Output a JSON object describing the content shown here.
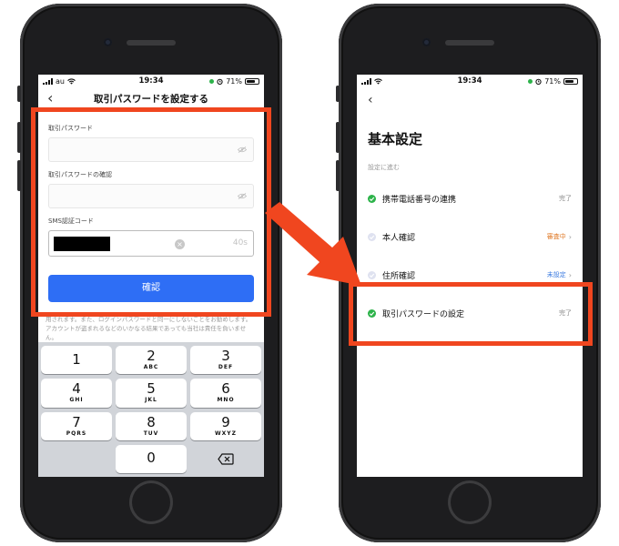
{
  "colors": {
    "highlight": "#f0461f",
    "confirm_button": "#2e6ef5",
    "done_green": "#2db34a",
    "review_orange": "#e07c2b",
    "unset_blue": "#3b7be0"
  },
  "left_screen": {
    "status": {
      "carrier": "au",
      "time": "19:34",
      "battery": "71%"
    },
    "nav": {
      "back": "‹",
      "title": "取引パスワードを設定する"
    },
    "form": {
      "password_label": "取引パスワード",
      "confirm_label": "取引パスワードの確認",
      "sms_label": "SMS認証コード",
      "timer": "40s"
    },
    "confirm_button": "確認",
    "notice": "用されます。また、ログインパスワードと同一にしないことをお勧めします。アカウントが盗まれるなどのいかなる結果であっても当社は責任を負いません。",
    "keypad": [
      {
        "n": "1",
        "l": ""
      },
      {
        "n": "2",
        "l": "ABC"
      },
      {
        "n": "3",
        "l": "DEF"
      },
      {
        "n": "4",
        "l": "GHI"
      },
      {
        "n": "5",
        "l": "JKL"
      },
      {
        "n": "6",
        "l": "MNO"
      },
      {
        "n": "7",
        "l": "PQRS"
      },
      {
        "n": "8",
        "l": "TUV"
      },
      {
        "n": "9",
        "l": "WXYZ"
      },
      {
        "n": "0",
        "l": ""
      }
    ]
  },
  "right_screen": {
    "status": {
      "time": "19:34",
      "battery": "71%"
    },
    "back": "‹",
    "title": "基本設定",
    "subtitle": "設定に進む",
    "steps": [
      {
        "name": "携帯電話番号の連携",
        "status": "完了",
        "state": "done"
      },
      {
        "name": "本人確認",
        "status": "審査中",
        "state": "review"
      },
      {
        "name": "住所確認",
        "status": "未設定",
        "state": "unset"
      },
      {
        "name": "取引パスワードの設定",
        "status": "完了",
        "state": "done"
      }
    ]
  }
}
